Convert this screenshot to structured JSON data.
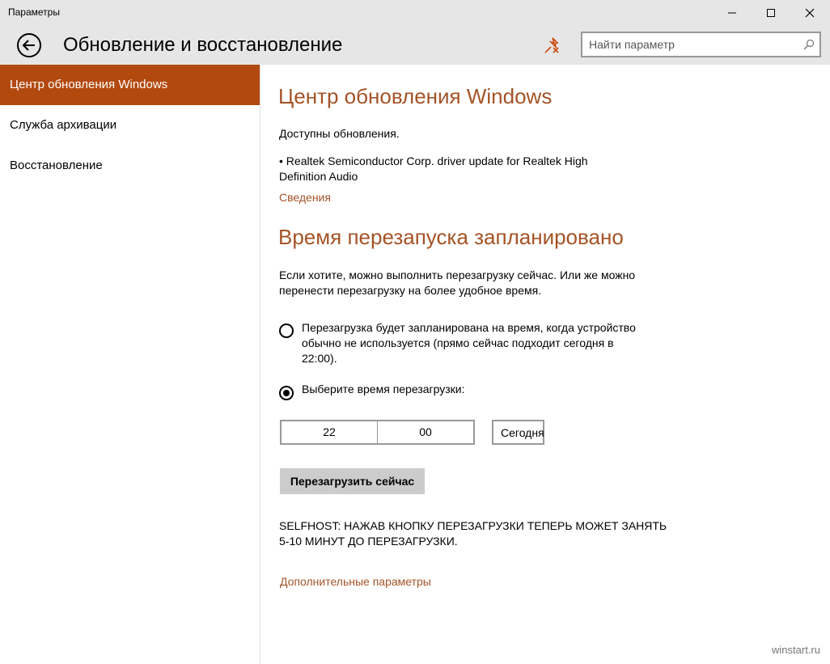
{
  "window": {
    "title": "Параметры",
    "minimize_icon": "minimize-icon",
    "maximize_icon": "maximize-icon",
    "close_icon": "close-icon"
  },
  "header": {
    "back_icon": "back-arrow-icon",
    "title": "Обновление и восстановление",
    "pin_icon": "pin-icon",
    "search_placeholder": "Найти параметр",
    "search_value": "",
    "search_icon": "search-icon"
  },
  "sidebar": {
    "items": [
      {
        "label": "Центр обновления Windows",
        "active": true
      },
      {
        "label": "Служба архивации",
        "active": false
      },
      {
        "label": "Восстановление",
        "active": false
      }
    ]
  },
  "main": {
    "section1_title": "Центр обновления Windows",
    "updates_available": "Доступны обновления.",
    "update_item_line1": "• Realtek Semiconductor Corp. driver update for Realtek High",
    "update_item_line2": "Definition Audio",
    "details_link": "Сведения",
    "section2_title": "Время перезапуска запланировано",
    "restart_desc_line1": "Если хотите, можно выполнить перезагрузку сейчас. Или же можно",
    "restart_desc_line2": "перенести перезагрузку на более удобное время.",
    "option_auto_line1": "Перезагрузка будет запланирована на время, когда устройство",
    "option_auto_line2": "обычно не используется (прямо сейчас подходит сегодня в",
    "option_auto_line3": "22:00).",
    "option_auto_selected": false,
    "option_manual": "Выберите время перезагрузки:",
    "option_manual_selected": true,
    "time_hour": "22",
    "time_minute": "00",
    "day": "Сегодня",
    "restart_now_button": "Перезагрузить сейчас",
    "selfhost_line1": "SELFHOST: НАЖАВ КНОПКУ ПЕРЕЗАГРУЗКИ ТЕПЕРЬ МОЖЕТ ЗАНЯТЬ",
    "selfhost_line2": "5-10 МИНУТ ДО ПЕРЕЗАГРУЗКИ.",
    "advanced_link": "Дополнительные параметры"
  },
  "watermark": "winstart.ru",
  "colors": {
    "accent": "#b24a10",
    "accent_text": "#a45326",
    "titlebar": "#e6e6e6"
  }
}
